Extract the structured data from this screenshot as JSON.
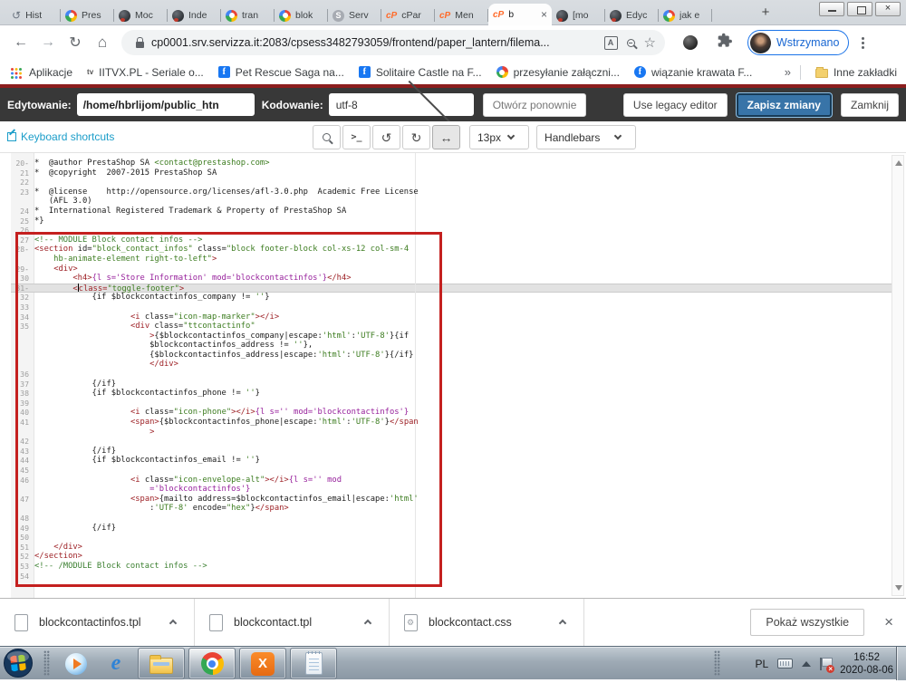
{
  "window": {
    "controls": [
      "minimize",
      "restore",
      "close"
    ]
  },
  "tabs": {
    "items": [
      {
        "icon": "history",
        "label": "Hist"
      },
      {
        "icon": "google",
        "label": "Pres"
      },
      {
        "icon": "site",
        "label": "Moc"
      },
      {
        "icon": "site",
        "label": "Inde"
      },
      {
        "icon": "google",
        "label": "tran"
      },
      {
        "icon": "google",
        "label": "blok"
      },
      {
        "icon": "servizza",
        "label": "Serv"
      },
      {
        "icon": "cpanel",
        "label": "cPar"
      },
      {
        "icon": "cpanel",
        "label": "Men"
      },
      {
        "icon": "cpanel",
        "label": "b",
        "active": 1
      },
      {
        "icon": "site",
        "label": "[mo"
      },
      {
        "icon": "site",
        "label": "Edyc"
      },
      {
        "icon": "google",
        "label": "jak e"
      }
    ],
    "close_glyph": "×",
    "new_tab_glyph": "+"
  },
  "toolbar": {
    "url": "cp0001.srv.servizza.it:2083/cpsess3482793059/frontend/paper_lantern/filema...",
    "profile_label": "Wstrzymano",
    "translate_glyph": "A"
  },
  "bookmarks": {
    "items": [
      {
        "icon": "apps",
        "label": "Aplikacje"
      },
      {
        "icon": "tv",
        "label": "IITVX.PL - Seriale o..."
      },
      {
        "icon": "facebook",
        "label": "Pet Rescue Saga na..."
      },
      {
        "icon": "facebook",
        "label": "Solitaire Castle na F..."
      },
      {
        "icon": "google",
        "label": "przesyłanie załączni..."
      },
      {
        "icon": "facebook-round",
        "label": "wiązanie krawata  F..."
      }
    ],
    "overflow_glyph": "»",
    "other_label": "Inne zakładki"
  },
  "cpanel": {
    "editing_label": "Edytowanie:",
    "path_value": "/home/hbrlijom/public_htn",
    "encoding_label": "Kodowanie:",
    "encoding_value": "utf-8",
    "reopen_label": "Otwórz ponownie",
    "legacy_label": "Use legacy editor",
    "save_label": "Zapisz zmiany",
    "close_label": "Zamknij"
  },
  "editor_toolbar": {
    "shortcuts_label": "Keyboard shortcuts",
    "terminal_glyph": ">_",
    "undo_glyph": "↺",
    "redo_glyph": "↻",
    "wrap_glyph": "↔",
    "font_size_value": "13px",
    "mode_value": "Handlebars"
  },
  "colors": {
    "save_button": "#3874a8",
    "toolbar_link": "#1b9dc9",
    "annotation_box": "#c4201f",
    "profile_accent": "#1a73e8",
    "syntax_tag": "#9d2025",
    "syntax_value": "#3c7c1f",
    "syntax_smarty": "#97219c",
    "syntax_comment": "#3c8031"
  },
  "editor": {
    "rows": [
      {
        "n": "20",
        "f": 1,
        "s": [
          [
            "p",
            "*  @author PrestaShop SA "
          ],
          [
            "val",
            "<contact@prestashop.com>"
          ]
        ]
      },
      {
        "n": "21",
        "s": [
          [
            "p",
            "*  @copyright  2007-2015 PrestaShop SA"
          ]
        ]
      },
      {
        "n": "22",
        "s": []
      },
      {
        "n": "23",
        "s": [
          [
            "p",
            "*  @license    http://opensource.org/licenses/afl-3.0.php  Academic Free License"
          ]
        ]
      },
      {
        "s": [
          [
            "p",
            "   (AFL 3.0)"
          ]
        ]
      },
      {
        "n": "24",
        "s": [
          [
            "p",
            "*  International Registered Trademark & Property of PrestaShop SA"
          ]
        ]
      },
      {
        "n": "25",
        "s": [
          [
            "p",
            "*}"
          ]
        ]
      },
      {
        "n": "26",
        "s": []
      },
      {
        "n": "27",
        "s": [
          [
            "com",
            "<!-- MODULE Block contact infos -->"
          ]
        ]
      },
      {
        "n": "28",
        "f": 1,
        "s": [
          [
            "tag",
            "<section"
          ],
          [
            "p",
            " id="
          ],
          [
            "val",
            "\"block_contact_infos\""
          ],
          [
            "p",
            " class="
          ],
          [
            "val",
            "\"block footer-block col-xs-12 col-sm-4"
          ]
        ]
      },
      {
        "s": [
          [
            "val",
            "    hb-animate-element right-to-left\""
          ],
          [
            "tag",
            ">"
          ]
        ]
      },
      {
        "n": "29",
        "f": 1,
        "s": [
          [
            "p",
            "    "
          ],
          [
            "tag",
            "<div>"
          ]
        ]
      },
      {
        "n": "30",
        "s": [
          [
            "p",
            "        "
          ],
          [
            "tag",
            "<h4>"
          ],
          [
            "sm",
            "{l s='Store Information' mod='blockcontactinfos'}"
          ],
          [
            "tag",
            "</h4>"
          ]
        ]
      },
      {
        "n": "31",
        "f": 1,
        "a": 1,
        "s": [
          [
            "p",
            "        "
          ],
          [
            "tag",
            "<"
          ],
          [
            "caret",
            ""
          ],
          [
            "tag",
            "class="
          ],
          [
            "val",
            "\"toggle-footer\""
          ],
          [
            "tag",
            ">"
          ]
        ]
      },
      {
        "n": "32",
        "s": [
          [
            "p",
            "            {if $blockcontactinfos_company != "
          ],
          [
            "val",
            "''"
          ],
          [
            "p",
            "}"
          ]
        ]
      },
      {
        "n": "33",
        "s": []
      },
      {
        "n": "34",
        "s": [
          [
            "p",
            "                    "
          ],
          [
            "tag",
            "<i"
          ],
          [
            "p",
            " class="
          ],
          [
            "val",
            "\"icon-map-marker\""
          ],
          [
            "tag",
            "></i>"
          ]
        ]
      },
      {
        "n": "35",
        "s": [
          [
            "p",
            "                    "
          ],
          [
            "tag",
            "<div"
          ],
          [
            "p",
            " class="
          ],
          [
            "val",
            "\"ttcontactinfo\""
          ]
        ]
      },
      {
        "s": [
          [
            "p",
            "                        "
          ],
          [
            "tag",
            ">"
          ],
          [
            "p",
            "{$blockcontactinfos_company|escape:"
          ],
          [
            "val",
            "'html'"
          ],
          [
            "p",
            ":"
          ],
          [
            "val",
            "'UTF-8'"
          ],
          [
            "p",
            "}{if"
          ]
        ]
      },
      {
        "s": [
          [
            "p",
            "                        $blockcontactinfos_address != "
          ],
          [
            "val",
            "''"
          ],
          [
            "p",
            "},"
          ]
        ]
      },
      {
        "s": [
          [
            "p",
            "                        {$blockcontactinfos_address|escape:"
          ],
          [
            "val",
            "'html'"
          ],
          [
            "p",
            ":"
          ],
          [
            "val",
            "'UTF-8'"
          ],
          [
            "p",
            "}{/if}"
          ]
        ]
      },
      {
        "s": [
          [
            "p",
            "                        "
          ],
          [
            "tag",
            "</div>"
          ]
        ]
      },
      {
        "n": "36",
        "s": []
      },
      {
        "n": "37",
        "s": [
          [
            "p",
            "            {/if}"
          ]
        ]
      },
      {
        "n": "38",
        "s": [
          [
            "p",
            "            {if $blockcontactinfos_phone != "
          ],
          [
            "val",
            "''"
          ],
          [
            "p",
            "}"
          ]
        ]
      },
      {
        "n": "39",
        "s": []
      },
      {
        "n": "40",
        "s": [
          [
            "p",
            "                    "
          ],
          [
            "tag",
            "<i"
          ],
          [
            "p",
            " class="
          ],
          [
            "val",
            "\"icon-phone\""
          ],
          [
            "tag",
            "></i>"
          ],
          [
            "sm",
            "{l s='' mod='blockcontactinfos'}"
          ]
        ]
      },
      {
        "n": "41",
        "s": [
          [
            "p",
            "                    "
          ],
          [
            "tag",
            "<span>"
          ],
          [
            "p",
            "{$blockcontactinfos_phone|escape:"
          ],
          [
            "val",
            "'html'"
          ],
          [
            "p",
            ":"
          ],
          [
            "val",
            "'UTF-8'"
          ],
          [
            "p",
            "}"
          ],
          [
            "tag",
            "</span"
          ]
        ]
      },
      {
        "s": [
          [
            "p",
            "                        "
          ],
          [
            "tag",
            ">"
          ]
        ]
      },
      {
        "n": "42",
        "s": []
      },
      {
        "n": "43",
        "s": [
          [
            "p",
            "            {/if}"
          ]
        ]
      },
      {
        "n": "44",
        "s": [
          [
            "p",
            "            {if $blockcontactinfos_email != "
          ],
          [
            "val",
            "''"
          ],
          [
            "p",
            "}"
          ]
        ]
      },
      {
        "n": "45",
        "s": []
      },
      {
        "n": "46",
        "s": [
          [
            "p",
            "                    "
          ],
          [
            "tag",
            "<i"
          ],
          [
            "p",
            " class="
          ],
          [
            "val",
            "\"icon-envelope-alt\""
          ],
          [
            "tag",
            "></i>"
          ],
          [
            "sm",
            "{l s='' mod"
          ]
        ]
      },
      {
        "s": [
          [
            "sm",
            "                        ='blockcontactinfos'}"
          ]
        ]
      },
      {
        "n": "47",
        "s": [
          [
            "p",
            "                    "
          ],
          [
            "tag",
            "<span>"
          ],
          [
            "p",
            "{mailto address=$blockcontactinfos_email|escape:"
          ],
          [
            "val",
            "'html'"
          ]
        ]
      },
      {
        "s": [
          [
            "p",
            "                        :"
          ],
          [
            "val",
            "'UTF-8'"
          ],
          [
            "p",
            " encode="
          ],
          [
            "val",
            "\"hex\""
          ],
          [
            "p",
            "}"
          ],
          [
            "tag",
            "</span>"
          ]
        ]
      },
      {
        "n": "48",
        "s": []
      },
      {
        "n": "49",
        "s": [
          [
            "p",
            "            {/if}"
          ]
        ]
      },
      {
        "n": "50",
        "s": []
      },
      {
        "n": "51",
        "s": [
          [
            "p",
            "    "
          ],
          [
            "tag",
            "</div>"
          ]
        ]
      },
      {
        "n": "52",
        "s": [
          [
            "tag",
            "</section>"
          ]
        ]
      },
      {
        "n": "53",
        "s": [
          [
            "com",
            "<!-- /MODULE Block contact infos -->"
          ]
        ]
      },
      {
        "n": "54",
        "s": []
      }
    ]
  },
  "downloads": {
    "items": [
      {
        "icon": "file",
        "label": "blockcontactinfos.tpl"
      },
      {
        "icon": "file",
        "label": "blockcontact.tpl"
      },
      {
        "icon": "file-gear",
        "label": "blockcontact.css"
      }
    ],
    "show_all_label": "Pokaż wszystkie",
    "close_glyph": "×"
  },
  "taskbar": {
    "apps": [
      {
        "name": "windows-media-player",
        "framed": 0
      },
      {
        "name": "internet-explorer",
        "framed": 0
      },
      {
        "name": "file-explorer",
        "framed": 1
      },
      {
        "name": "chrome",
        "framed": 1,
        "active": 1
      },
      {
        "name": "xampp",
        "framed": 1
      },
      {
        "name": "notepad",
        "framed": 1
      }
    ],
    "lang_label": "PL",
    "time": "16:52",
    "date": "2020-08-06"
  }
}
